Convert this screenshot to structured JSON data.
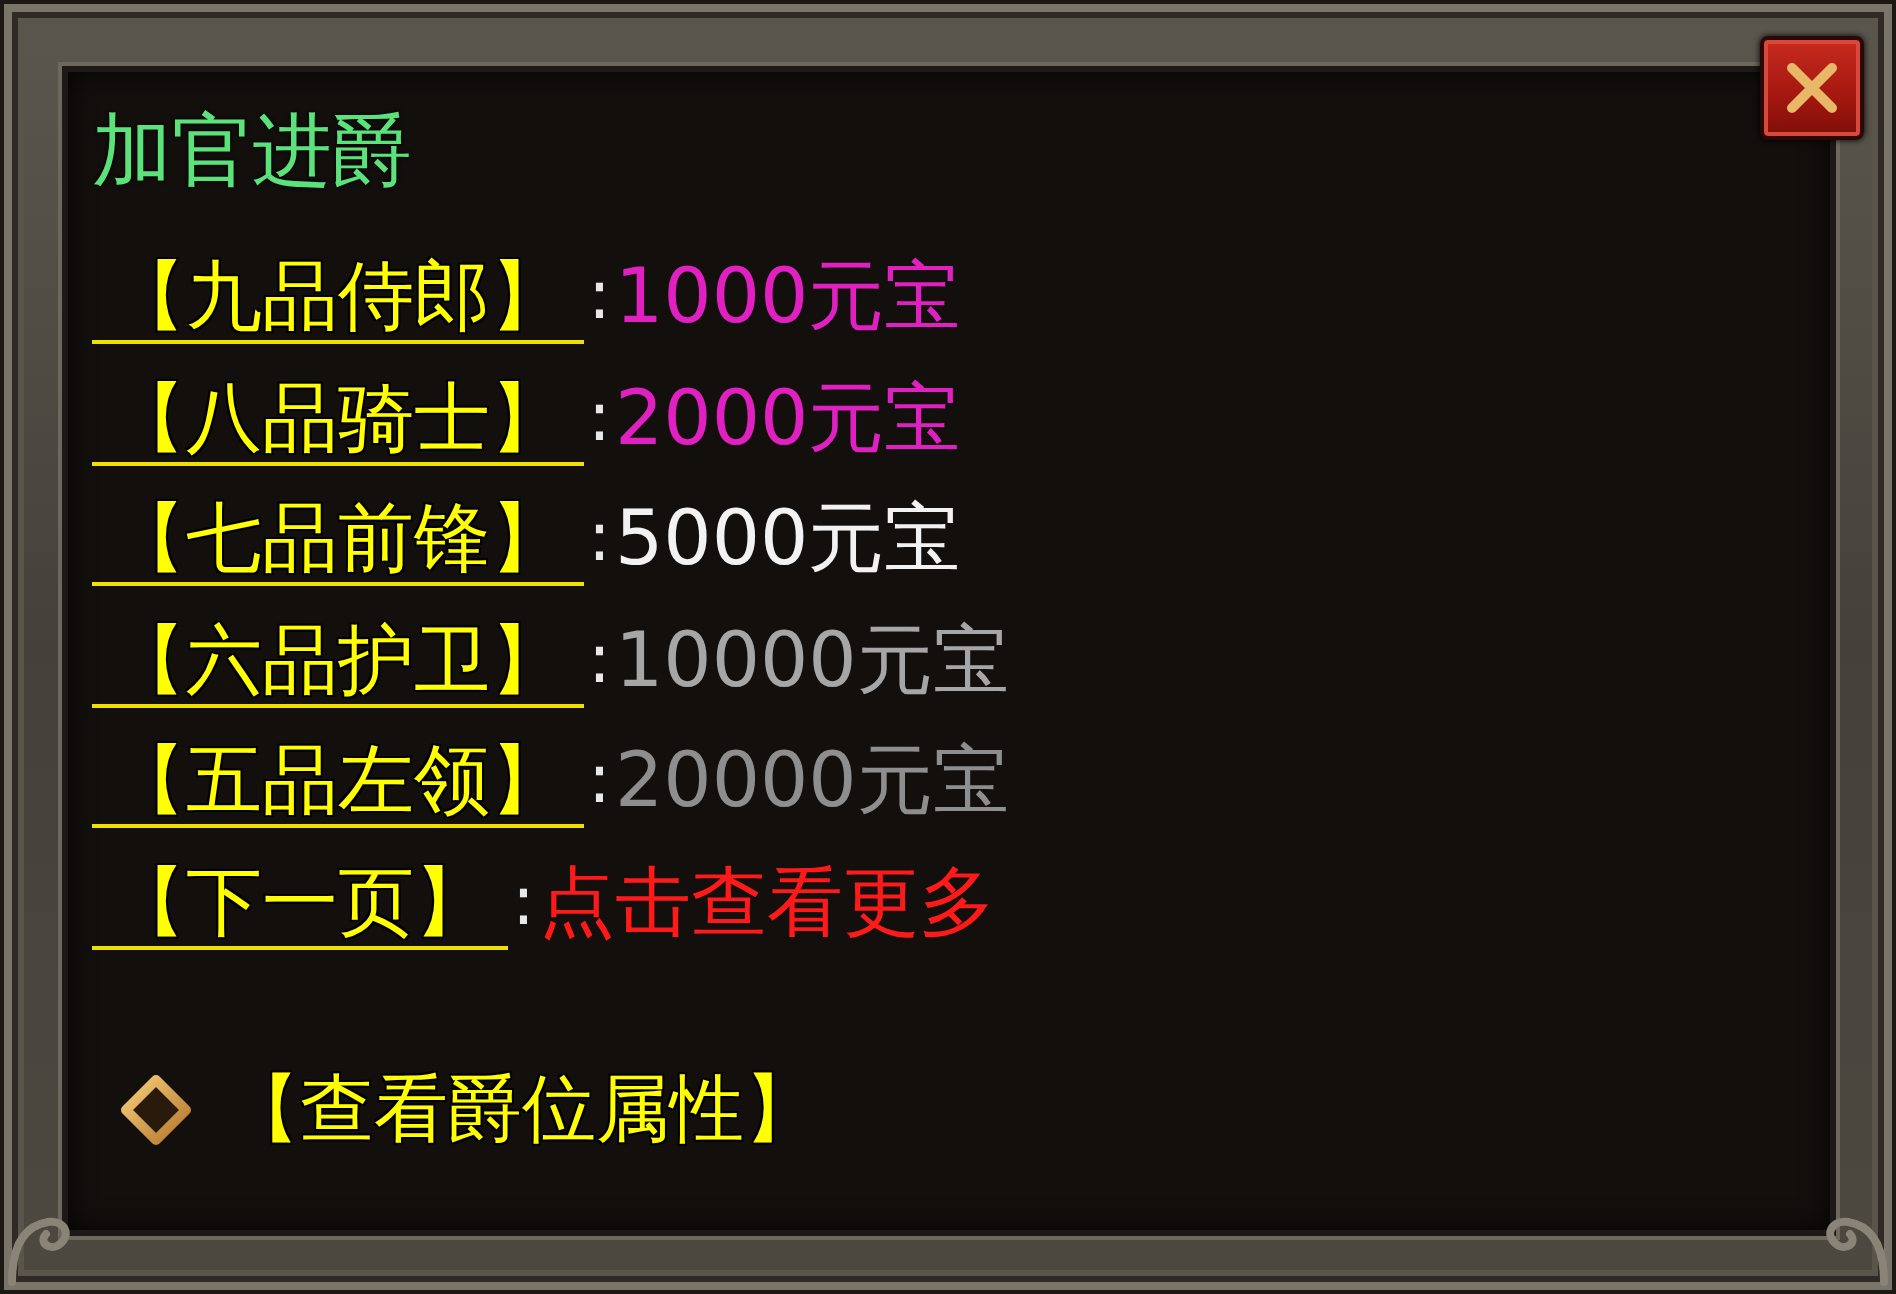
{
  "window": {
    "title": "加官进爵"
  },
  "rows": [
    {
      "label": "【九品侍郎】",
      "separator": ":",
      "value": "1000元宝",
      "color": "#e020c0"
    },
    {
      "label": "【八品骑士】",
      "separator": ":",
      "value": "2000元宝",
      "color": "#e020c0"
    },
    {
      "label": "【七品前锋】",
      "separator": ":",
      "value": "5000元宝",
      "color": "#f2f2f2"
    },
    {
      "label": "【六品护卫】",
      "separator": ":",
      "value": "10000元宝",
      "color": "#a6a6a6"
    },
    {
      "label": "【五品左领】",
      "separator": ":",
      "value": "20000元宝",
      "color": "#8e8e8e"
    },
    {
      "label": "【下一页】",
      "separator": ":",
      "value": "点击查看更多",
      "color": "#ff1a1a"
    }
  ],
  "attribute_link": {
    "label": "【查看爵位属性】"
  }
}
